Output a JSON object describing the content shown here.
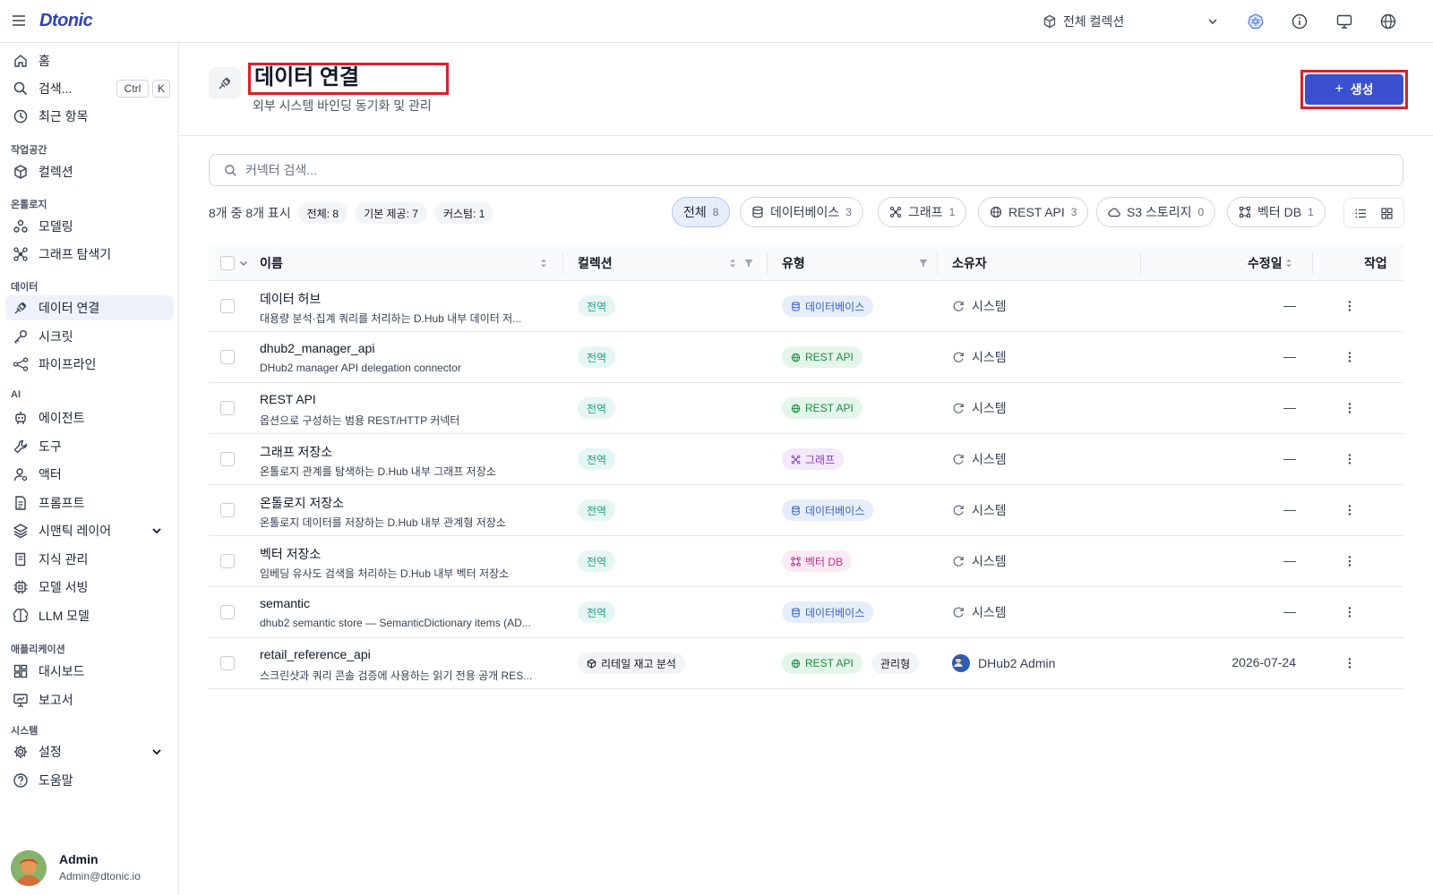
{
  "app": {
    "logo": "Dtonic"
  },
  "topbar": {
    "collection_label": "전체 컬렉션"
  },
  "sidebar": {
    "items": [
      {
        "label": "홈",
        "icon": "home-icon"
      },
      {
        "label": "검색...",
        "icon": "search-icon",
        "shortcut": [
          "Ctrl",
          "K"
        ]
      },
      {
        "label": "최근 항목",
        "icon": "clock-icon"
      }
    ],
    "sections": [
      {
        "label": "작업공간",
        "items": [
          {
            "label": "컬렉션",
            "icon": "cube-icon"
          }
        ]
      },
      {
        "label": "온톨로지",
        "items": [
          {
            "label": "모델링",
            "icon": "ontology-icon"
          },
          {
            "label": "그래프 탐색기",
            "icon": "graph-explorer-icon"
          }
        ]
      },
      {
        "label": "데이터",
        "items": [
          {
            "label": "데이터 연결",
            "icon": "plug-icon",
            "active": true
          },
          {
            "label": "시크릿",
            "icon": "key-icon"
          },
          {
            "label": "파이프라인",
            "icon": "pipeline-icon"
          }
        ]
      },
      {
        "label": "AI",
        "items": [
          {
            "label": "에이전트",
            "icon": "agent-icon"
          },
          {
            "label": "도구",
            "icon": "wrench-icon"
          },
          {
            "label": "액터",
            "icon": "actor-icon"
          },
          {
            "label": "프롬프트",
            "icon": "prompt-icon"
          },
          {
            "label": "시맨틱 레이어",
            "icon": "layers-icon"
          },
          {
            "label": "지식 관리",
            "icon": "book-icon"
          },
          {
            "label": "모델 서빙",
            "icon": "chip-icon"
          },
          {
            "label": "LLM 모델",
            "icon": "brain-icon"
          }
        ]
      },
      {
        "label": "애플리케이션",
        "items": [
          {
            "label": "대시보드",
            "icon": "dashboard-icon"
          },
          {
            "label": "보고서",
            "icon": "report-icon"
          }
        ]
      },
      {
        "label": "시스템",
        "items": [
          {
            "label": "설정",
            "icon": "gear-icon"
          },
          {
            "label": "도움말",
            "icon": "help-icon"
          }
        ]
      }
    ],
    "user": {
      "name": "Admin",
      "email": "Admin@dtonic.io"
    }
  },
  "page": {
    "title": "데이터 연결",
    "subtitle": "외부 시스템 바인딩 동기화 및 관리",
    "create_label": "생성",
    "search_placeholder": "커넥터 검색..."
  },
  "summary": {
    "text": "8개 중 8개 표시",
    "pills": [
      "전체: 8",
      "기본 제공: 7",
      "커스텀: 1"
    ]
  },
  "filters": [
    {
      "label": "전체",
      "count": "8"
    },
    {
      "label": "데이터베이스",
      "count": "3"
    },
    {
      "label": "그래프",
      "count": "1"
    },
    {
      "label": "REST API",
      "count": "3"
    },
    {
      "label": "S3 스토리지",
      "count": "0"
    },
    {
      "label": "벡터 DB",
      "count": "1"
    }
  ],
  "table": {
    "columns": [
      "이름",
      "컬렉션",
      "유형",
      "소유자",
      "수정일",
      "작업"
    ],
    "rows": [
      {
        "name": "데이터 허브",
        "desc": "대용량 분석·집계 쿼리를 처리하는 D.Hub 내부 데이터 저...",
        "collection": "전역",
        "type": "데이터베이스",
        "owner": "시스템",
        "modified": "—"
      },
      {
        "name": "dhub2_manager_api",
        "desc": "DHub2 manager API delegation connector",
        "collection": "전역",
        "type": "REST API",
        "owner": "시스템",
        "modified": "—"
      },
      {
        "name": "REST API",
        "desc": "옵션으로 구성하는 범용 REST/HTTP 커넥터",
        "collection": "전역",
        "type": "REST API",
        "owner": "시스템",
        "modified": "—"
      },
      {
        "name": "그래프 저장소",
        "desc": "온톨로지 관계를 탐색하는 D.Hub 내부 그래프 저장소",
        "collection": "전역",
        "type": "그래프",
        "owner": "시스템",
        "modified": "—"
      },
      {
        "name": "온톨로지 저장소",
        "desc": "온톨로지 데이터를 저장하는 D.Hub 내부 관계형 저장소",
        "collection": "전역",
        "type": "데이터베이스",
        "owner": "시스템",
        "modified": "—"
      },
      {
        "name": "벡터 저장소",
        "desc": "임베딩 유사도 검색을 처리하는 D.Hub 내부 벡터 저장소",
        "collection": "전역",
        "type": "벡터 DB",
        "owner": "시스템",
        "modified": "—"
      },
      {
        "name": "semantic",
        "desc": "dhub2 semantic store — SemanticDictionary items (AD...",
        "collection": "전역",
        "type": "데이터베이스",
        "owner": "시스템",
        "modified": "—"
      },
      {
        "name": "retail_reference_api",
        "desc": "스크린샷과 쿼리 콘솔 검증에 사용하는 읽기 전용 공개 RES...",
        "collection": "리테일 재고 분석",
        "type": "REST API",
        "type_extra": "관리형",
        "owner": "DHub2 Admin",
        "modified": "2026-07-24"
      }
    ]
  },
  "colors": {
    "accent": "#3a50cf",
    "highlight": "#e11d2a"
  }
}
